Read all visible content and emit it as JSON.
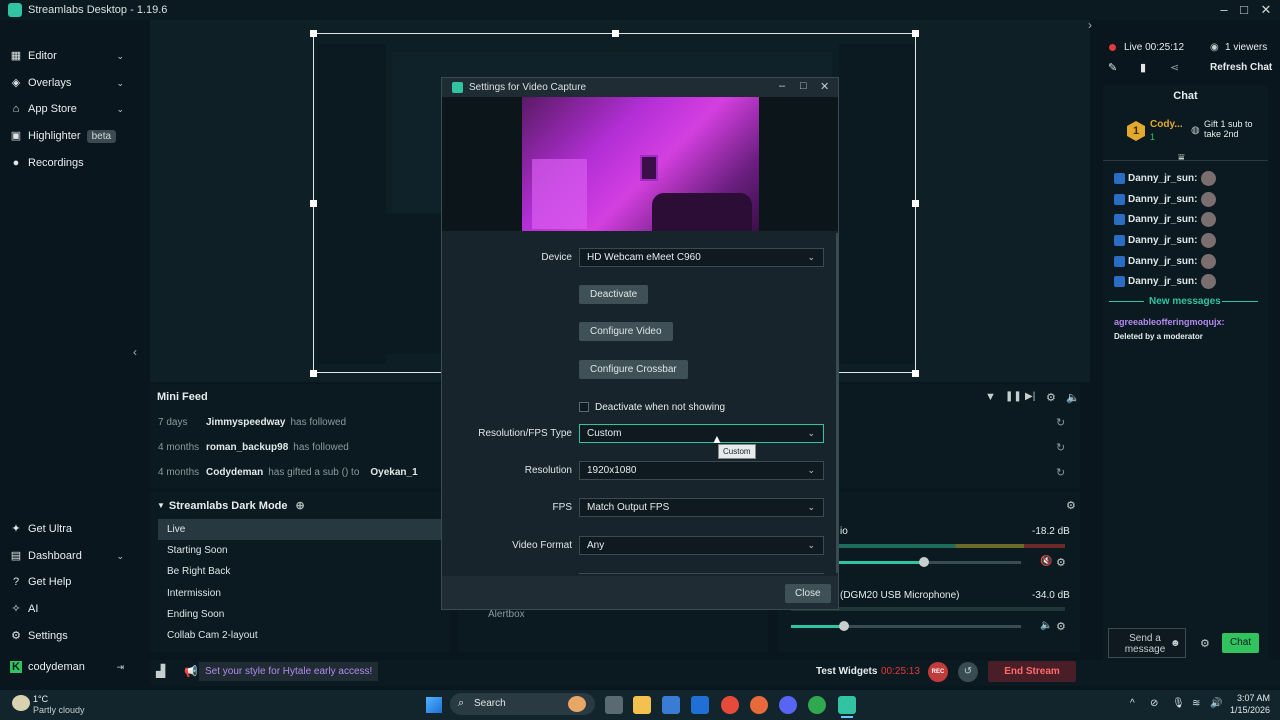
{
  "app": {
    "title": "Streamlabs Desktop - 1.19.6"
  },
  "nav": {
    "items": [
      {
        "label": "Editor",
        "chevron": true
      },
      {
        "label": "Overlays",
        "chevron": true
      },
      {
        "label": "App Store",
        "chevron": true
      },
      {
        "label": "Highlighter",
        "badge": "beta"
      },
      {
        "label": "Recordings"
      }
    ],
    "bottom": [
      {
        "label": "Get Ultra"
      },
      {
        "label": "Dashboard",
        "chevron": true
      },
      {
        "label": "Get Help"
      },
      {
        "label": "AI"
      },
      {
        "label": "Settings"
      }
    ],
    "user": "codydeman"
  },
  "live": {
    "status": "Live 00:25:12",
    "viewers": "1 viewers",
    "refresh": "Refresh Chat"
  },
  "minifeed": {
    "title": "Mini Feed",
    "rows": [
      {
        "time": "7 days",
        "user": "Jimmyspeedway",
        "action": "has followed",
        "target": ""
      },
      {
        "time": "4 months",
        "user": "roman_backup98",
        "action": "has followed",
        "target": ""
      },
      {
        "time": "4 months",
        "user": "Codydeman",
        "action": "has gifted a sub () to",
        "target": "Oyekan_1"
      }
    ]
  },
  "scenes": {
    "title": "Streamlabs Dark Mode",
    "items": [
      "Live",
      "Starting Soon",
      "Be Right Back",
      "Intermission",
      "Ending Soon",
      "Collab Cam 2-layout"
    ]
  },
  "sources": {
    "partial": "Alertbox"
  },
  "mixer": {
    "row1": {
      "name": "io",
      "db": "-18.2 dB",
      "level": 0.58
    },
    "row2": {
      "name": "(DGM20 USB Microphone)",
      "db": "-34.0 dB",
      "level": 0.23
    }
  },
  "dialog": {
    "title": "Settings for Video Capture",
    "device_label": "Device",
    "device": "HD Webcam eMeet C960",
    "deactivate": "Deactivate",
    "configure_video": "Configure Video",
    "configure_crossbar": "Configure Crossbar",
    "deactivate_when": "Deactivate when not showing",
    "res_type_label": "Resolution/FPS Type",
    "res_type": "Custom",
    "tooltip": "Custom",
    "res_label": "Resolution",
    "res": "1920x1080",
    "fps_label": "FPS",
    "fps": "Match Output FPS",
    "format_label": "Video Format",
    "format": "Any",
    "close": "Close"
  },
  "chat": {
    "title": "Chat",
    "goal_user": "Cody...",
    "goal_count": "1",
    "gift": "Gift 1 sub to take 2nd",
    "users": [
      "Danny_jr_sun:",
      "Danny_jr_sun:",
      "Danny_jr_sun:",
      "Danny_jr_sun:",
      "Danny_jr_sun:",
      "Danny_jr_sun:"
    ],
    "new_messages": "New messages",
    "mod_user": "agreeableofferingmoqujx:",
    "mod_msg": "Deleted by a moderator",
    "placeholder": "Send a message",
    "send": "Chat"
  },
  "footer": {
    "promo": "Set your style for Hytale early access!",
    "test_widgets": "Test Widgets",
    "timer": "00:25:13",
    "rec": "REC",
    "end_stream": "End Stream"
  },
  "taskbar": {
    "weather_temp": "1°C",
    "weather_desc": "Partly cloudy",
    "search": "Search",
    "time": "3:07 AM",
    "date": "1/15/2026"
  }
}
